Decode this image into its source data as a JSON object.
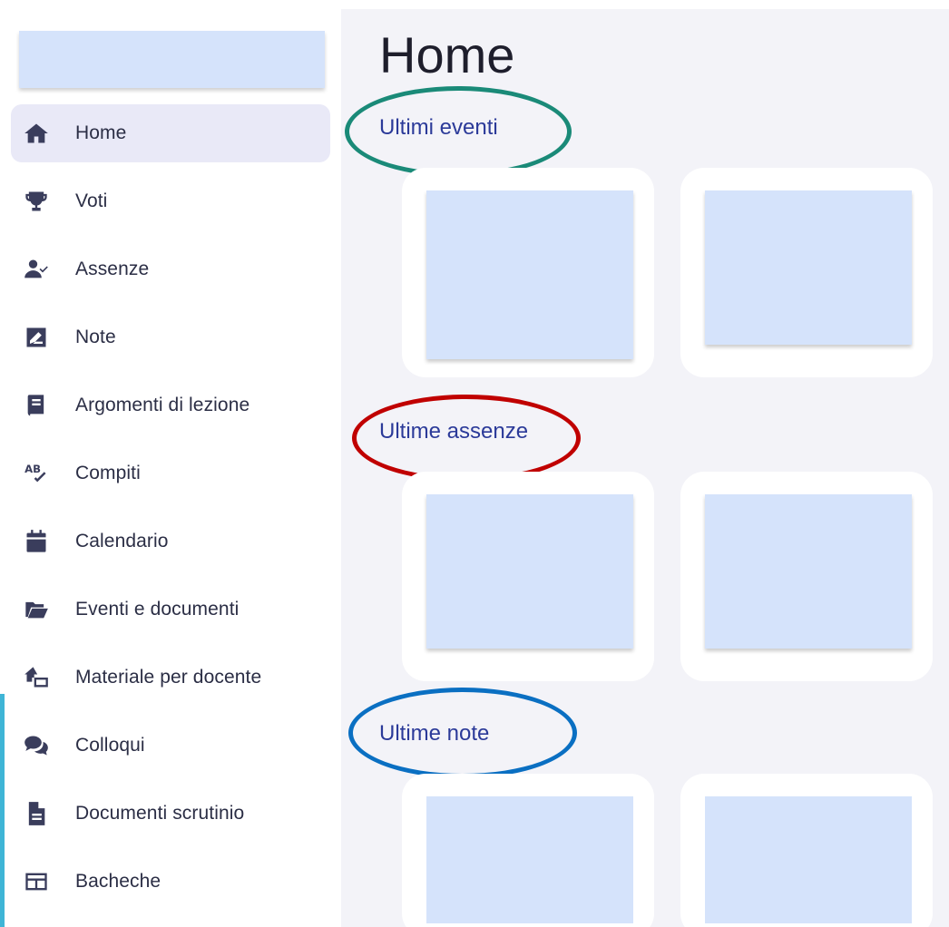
{
  "sidebar": {
    "items": [
      {
        "label": "Home",
        "icon": "home-icon",
        "active": true
      },
      {
        "label": "Voti",
        "icon": "trophy-icon"
      },
      {
        "label": "Assenze",
        "icon": "user-check-icon"
      },
      {
        "label": "Note",
        "icon": "note-edit-icon"
      },
      {
        "label": "Argomenti di lezione",
        "icon": "book-icon"
      },
      {
        "label": "Compiti",
        "icon": "spellcheck-icon"
      },
      {
        "label": "Calendario",
        "icon": "calendar-icon"
      },
      {
        "label": "Eventi e documenti",
        "icon": "folder-open-icon"
      },
      {
        "label": "Materiale per docente",
        "icon": "house-share-icon"
      },
      {
        "label": "Colloqui",
        "icon": "chat-bubbles-icon"
      },
      {
        "label": "Documenti scrutinio",
        "icon": "document-icon"
      },
      {
        "label": "Bacheche",
        "icon": "board-icon"
      }
    ]
  },
  "main": {
    "title": "Home",
    "sections": [
      {
        "title": "Ultimi eventi",
        "highlight_color": "#1a8a78"
      },
      {
        "title": "Ultime assenze",
        "highlight_color": "#c00000"
      },
      {
        "title": "Ultime note",
        "highlight_color": "#0a6fc2"
      }
    ]
  },
  "colors": {
    "placeholder_fill": "#d5e3fb",
    "active_nav_bg": "#e9e9f7",
    "section_title": "#2b3a99",
    "main_bg": "#f3f3f8",
    "side_accent": "#3fb5d6"
  }
}
